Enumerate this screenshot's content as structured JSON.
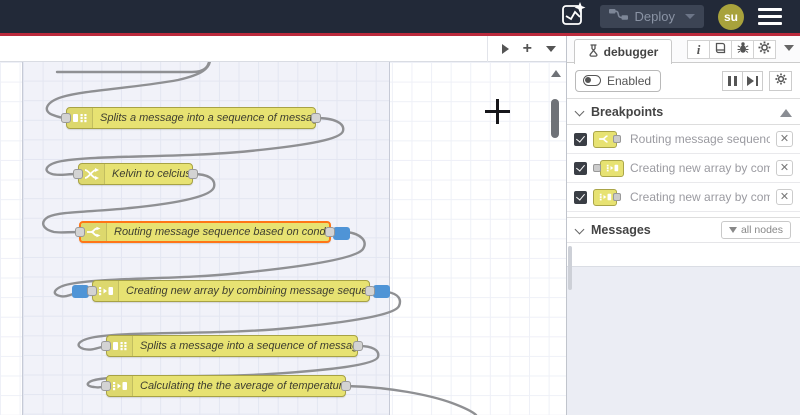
{
  "header": {
    "deploy": {
      "label": "Deploy"
    },
    "avatar": {
      "initials": "su"
    }
  },
  "canvas": {
    "nodes": [
      {
        "id": "split-1",
        "label": "Splits a message into a sequence of messages.",
        "icon": "split-icon"
      },
      {
        "id": "change-1",
        "label": "Kelvin to celcius",
        "icon": "change-icon"
      },
      {
        "id": "switch-1",
        "label": "Routing message sequence based on condition",
        "icon": "switch-icon",
        "selected": true,
        "breakpoints": [
          "output"
        ]
      },
      {
        "id": "join-1",
        "label": "Creating new array by combining message sequence",
        "icon": "join-icon",
        "breakpoints": [
          "input",
          "output"
        ]
      },
      {
        "id": "split-2",
        "label": "Splits a message into a sequence of messages.",
        "icon": "split-icon"
      },
      {
        "id": "join-2",
        "label": "Calculating the the average of temperature",
        "icon": "join-icon"
      }
    ]
  },
  "sidebar": {
    "tab": {
      "label": "debugger"
    },
    "toolbar": {
      "enabled_label": "Enabled"
    },
    "breakpoints": {
      "title": "Breakpoints",
      "items": [
        {
          "label": "Routing message sequence based on condition",
          "checked": true,
          "icon": "switch-icon",
          "port": "output"
        },
        {
          "label": "Creating new array by combining message sequence",
          "checked": true,
          "icon": "join-icon",
          "port": "input"
        },
        {
          "label": "Creating new array by combining message sequence",
          "checked": true,
          "icon": "join-icon",
          "port": "output"
        }
      ]
    },
    "messages": {
      "title": "Messages",
      "filter_label": "all nodes"
    }
  },
  "colors": {
    "header_bg": "#222938",
    "accent_red": "#bb2a3c",
    "node_fill": "#e7e272",
    "node_border": "#a7a244",
    "selected_border": "#ff7616",
    "breakpoint_blue": "#4f94d6",
    "wire": "#8f9093"
  }
}
